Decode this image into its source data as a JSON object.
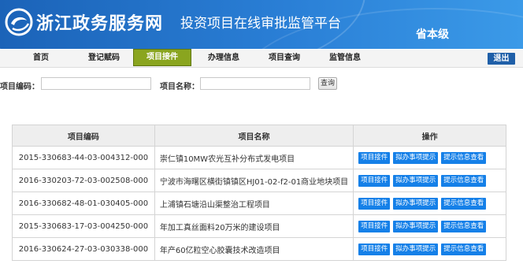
{
  "header": {
    "title": "浙江政务服务网",
    "subtitle": "投资项目在线审批监管平台",
    "level": "省本级"
  },
  "nav": {
    "items": [
      {
        "label": "首页"
      },
      {
        "label": "登记赋码"
      },
      {
        "label": "项目接件"
      },
      {
        "label": "办理信息"
      },
      {
        "label": "项目查询"
      },
      {
        "label": "监管信息"
      }
    ],
    "active_index": 2,
    "logout_label": "退出"
  },
  "search": {
    "code_label": "项目编码：",
    "code_value": "",
    "name_label": "项目名称：",
    "name_value": "",
    "button_label": "查询"
  },
  "table": {
    "headers": [
      "项目编码",
      "项目名称",
      "操作"
    ],
    "rows": [
      {
        "code": "2015-330683-44-03-004312-000",
        "name": "崇仁镇10MW农光互补分布式发电项目"
      },
      {
        "code": "2016-330203-72-03-002508-000",
        "name": "宁波市海曙区横街镇镇区HJ01-02-f2-01商业地块项目"
      },
      {
        "code": "2016-330682-48-01-030405-000",
        "name": "上浦镇石塘沿山渠整治工程项目"
      },
      {
        "code": "2015-330683-17-03-004250-000",
        "name": "年加工真丝面料20万米的建设项目"
      },
      {
        "code": "2016-330624-27-03-030338-000",
        "name": "年产60亿粒空心胶囊技术改造项目"
      }
    ],
    "actions": [
      "项目接件",
      "拟办事项提示",
      "提示信息查看"
    ]
  },
  "colors": {
    "banner": "#2a7fd6",
    "nav_active": "#8aa51f",
    "action_button": "#1580e8",
    "logout": "#1f5fa8"
  }
}
